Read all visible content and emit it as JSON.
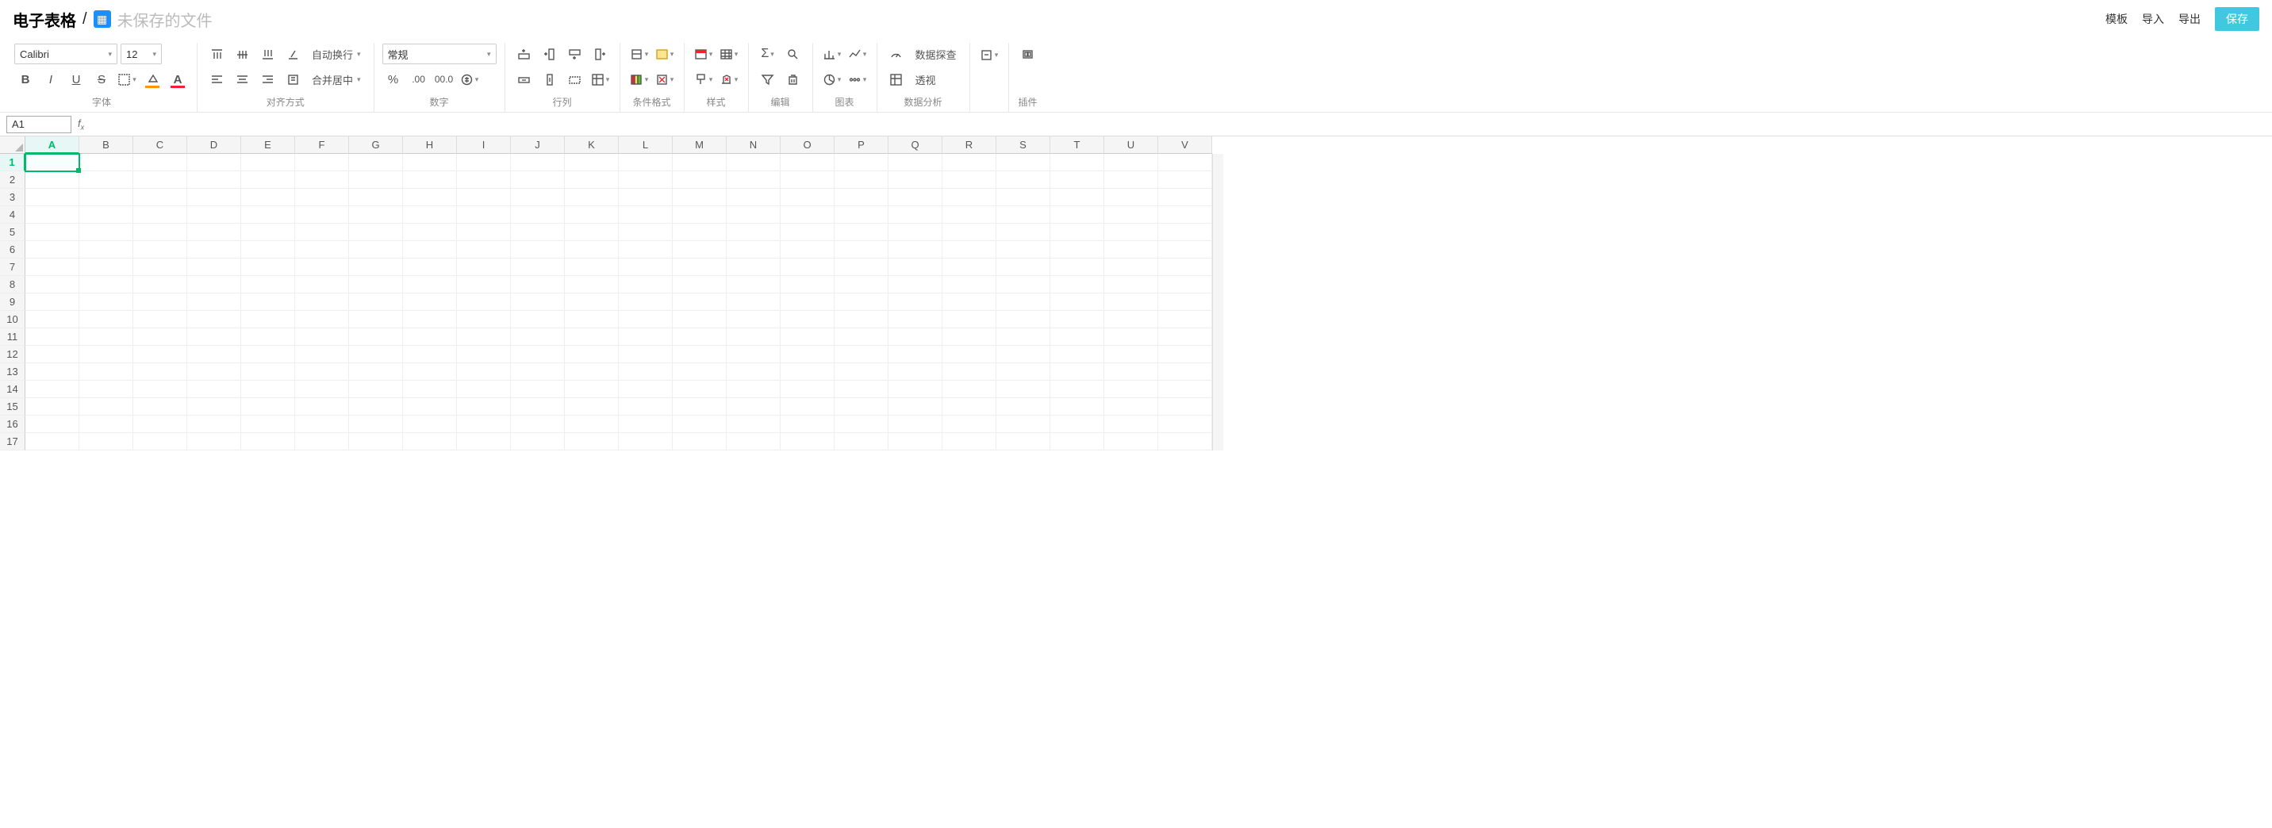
{
  "header": {
    "app_name": "电子表格",
    "slash": "/",
    "doc_title": "未保存的文件",
    "links": {
      "template": "模板",
      "import": "导入",
      "export": "导出"
    },
    "save": "保存"
  },
  "ribbon": {
    "font": {
      "label": "字体",
      "family": "Calibri",
      "size": "12"
    },
    "align": {
      "label": "对齐方式",
      "wrap": "自动换行",
      "merge": "合并居中"
    },
    "number": {
      "label": "数字",
      "format": "常规"
    },
    "rowcol": {
      "label": "行列"
    },
    "cond": {
      "label": "条件格式"
    },
    "style": {
      "label": "样式"
    },
    "edit": {
      "label": "编辑"
    },
    "chart": {
      "label": "图表"
    },
    "analysis": {
      "label": "数据分析",
      "explore": "数据探查",
      "pivot": "透视"
    },
    "plugin": {
      "label": "插件"
    }
  },
  "formula_bar": {
    "name_box": "A1"
  },
  "grid": {
    "columns": [
      "A",
      "B",
      "C",
      "D",
      "E",
      "F",
      "G",
      "H",
      "I",
      "J",
      "K",
      "L",
      "M",
      "N",
      "O",
      "P",
      "Q",
      "R",
      "S",
      "T",
      "U",
      "V"
    ],
    "rows": [
      "1",
      "2",
      "3",
      "4",
      "5",
      "6",
      "7",
      "8",
      "9",
      "10",
      "11",
      "12",
      "13",
      "14",
      "15",
      "16",
      "17"
    ],
    "active_col": "A",
    "active_row": "1"
  }
}
